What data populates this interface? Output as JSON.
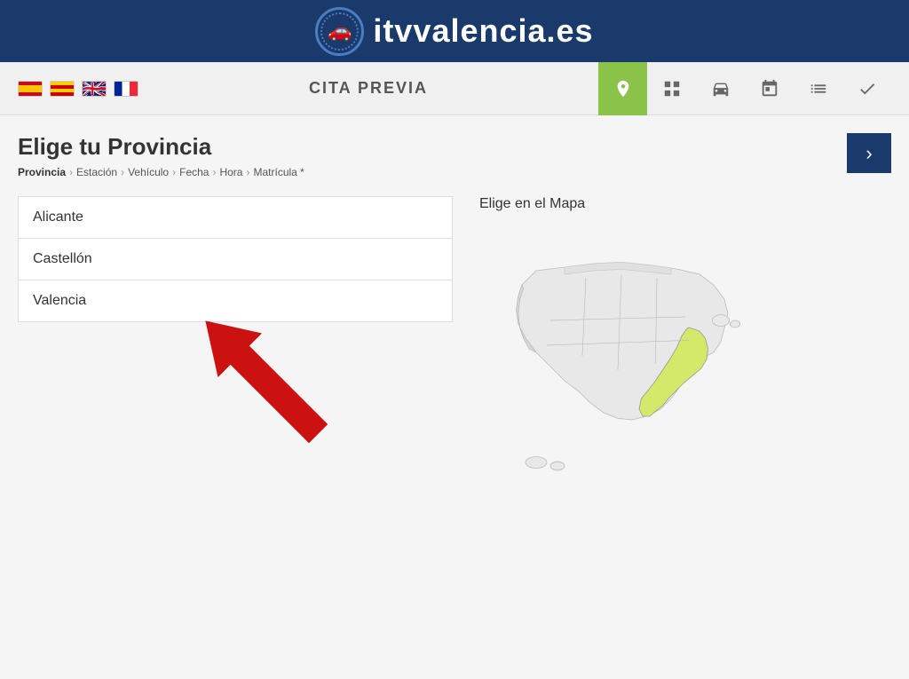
{
  "header": {
    "site_name": "itvvalencia.es",
    "logo_icon": "🚗"
  },
  "navbar": {
    "title": "CITA PREVIA",
    "flags": [
      {
        "code": "es",
        "label": "Español"
      },
      {
        "code": "val",
        "label": "Valenciano"
      },
      {
        "code": "uk",
        "label": "English"
      },
      {
        "code": "fr",
        "label": "Français"
      }
    ],
    "nav_icons": [
      {
        "name": "location",
        "symbol": "📍",
        "active": true
      },
      {
        "name": "grid",
        "symbol": "⊞",
        "active": false
      },
      {
        "name": "car",
        "symbol": "🚗",
        "active": false
      },
      {
        "name": "calendar",
        "symbol": "📅",
        "active": false
      },
      {
        "name": "list",
        "symbol": "☰",
        "active": false
      },
      {
        "name": "check",
        "symbol": "✓",
        "active": false
      }
    ]
  },
  "page": {
    "title": "Elige tu Provincia",
    "breadcrumb": [
      "Provincia",
      "Estación",
      "Vehículo",
      "Fecha",
      "Hora",
      "Matrícula *"
    ],
    "next_button_label": "›",
    "map_title": "Elige en el Mapa",
    "provinces": [
      {
        "name": "Alicante"
      },
      {
        "name": "Castellón"
      },
      {
        "name": "Valencia"
      }
    ]
  }
}
